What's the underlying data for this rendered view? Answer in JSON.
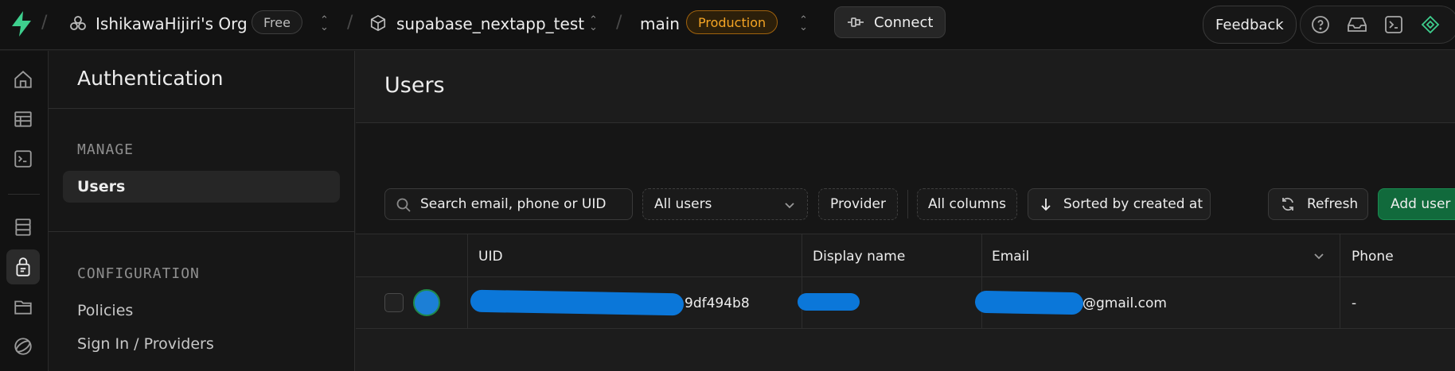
{
  "topbar": {
    "org_name": "IshikawaHijiri's Org",
    "plan_badge": "Free",
    "project_name": "supabase_nextapp_test",
    "branch_name": "main",
    "env_badge": "Production",
    "connect_label": "Connect",
    "feedback_label": "Feedback",
    "separator": "/"
  },
  "sidebar": {
    "title": "Authentication",
    "section_manage": "MANAGE",
    "manage_items": [
      {
        "label": "Users"
      }
    ],
    "section_configuration": "CONFIGURATION",
    "config_items": [
      {
        "label": "Policies"
      },
      {
        "label": "Sign In / Providers"
      }
    ]
  },
  "main": {
    "title": "Users",
    "search_placeholder": "Search email, phone or UID",
    "filter_users": "All users",
    "provider_label": "Provider",
    "columns_label": "All columns",
    "sort_label": "Sorted by created at",
    "refresh_label": "Refresh",
    "add_user_label": "Add user"
  },
  "table": {
    "columns": [
      "UID",
      "Display name",
      "Email",
      "Phone"
    ],
    "rows": [
      {
        "uid_visible": "9df494b8",
        "email_visible": "@gmail.com",
        "phone": "-"
      }
    ]
  },
  "colors": {
    "accent_green": "#3ecf8e",
    "production_orange": "#f5a524",
    "redaction_blue": "#0b77d9"
  }
}
